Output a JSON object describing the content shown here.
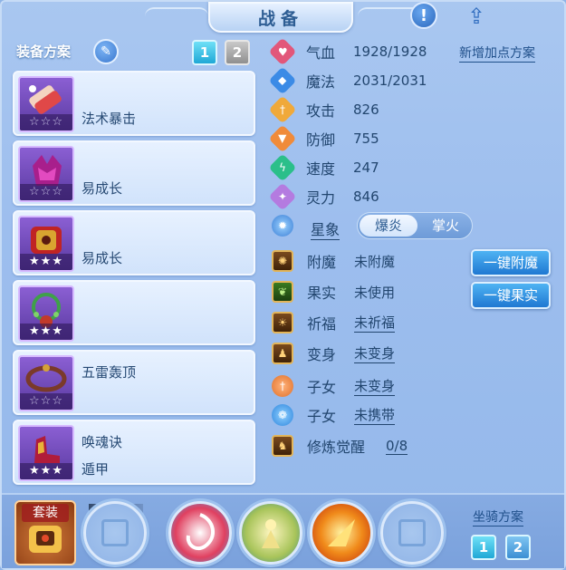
{
  "title": "战备",
  "equip_scheme": {
    "label": "装备方案",
    "tabs": [
      "1",
      "2"
    ],
    "active_tab": "1"
  },
  "equipment": [
    {
      "name": "法术暴击",
      "name2": "",
      "stars": 3,
      "filled": false,
      "color": "#d24a4a"
    },
    {
      "name": "易成长",
      "name2": "",
      "stars": 3,
      "filled": false,
      "color": "#b0209c"
    },
    {
      "name": "易成长",
      "name2": "",
      "stars": 3,
      "filled": true,
      "color": "#c2661c"
    },
    {
      "name": "",
      "name2": "",
      "stars": 3,
      "filled": true,
      "color": "#2f8a3a"
    },
    {
      "name": "五雷轰顶",
      "name2": "",
      "stars": 3,
      "filled": false,
      "color": "#8a3a2a"
    },
    {
      "name": "唤魂诀",
      "name2": "遁甲",
      "stars": 3,
      "filled": true,
      "color": "#b21c3a"
    }
  ],
  "attributes": [
    {
      "label": "气血",
      "value": "1928/1928",
      "icon": "heart-icon",
      "color": "#e2577a"
    },
    {
      "label": "魔法",
      "value": "2031/2031",
      "icon": "mana-icon",
      "color": "#3b8be6"
    },
    {
      "label": "攻击",
      "value": "826",
      "icon": "attack-icon",
      "color": "#f0a93a"
    },
    {
      "label": "防御",
      "value": "755",
      "icon": "defense-icon",
      "color": "#f08b3a"
    },
    {
      "label": "速度",
      "value": "247",
      "icon": "speed-icon",
      "color": "#2bbf8a"
    },
    {
      "label": "灵力",
      "value": "846",
      "icon": "spirit-icon",
      "color": "#b47be0"
    }
  ],
  "new_scheme_link": "新增加点方案",
  "constellation": {
    "label": "星象",
    "options": [
      "爆炎",
      "掌火"
    ],
    "selected": "爆炎"
  },
  "extras": [
    {
      "label": "附魔",
      "value": "未附魔",
      "underline": false,
      "icon": "enchant-icon"
    },
    {
      "label": "果实",
      "value": "未使用",
      "underline": false,
      "icon": "fruit-icon"
    },
    {
      "label": "祈福",
      "value": "未祈福",
      "underline": true,
      "icon": "blessing-icon"
    },
    {
      "label": "变身",
      "value": "未变身",
      "underline": true,
      "icon": "transform-icon"
    },
    {
      "label": "子女",
      "value": "未变身",
      "underline": true,
      "icon": "child-transform-icon"
    },
    {
      "label": "子女",
      "value": "未携带",
      "underline": true,
      "icon": "pet-paw-icon"
    },
    {
      "label": "修炼觉醒",
      "value": "0/8",
      "underline": true,
      "icon": "cultivation-icon"
    }
  ],
  "buttons": {
    "one_click_enchant": "一键附魔",
    "one_click_fruit": "一键果实"
  },
  "bottom": {
    "suit_label": "套装",
    "soul_skill_label": "魂技",
    "mount_scheme_label": "坐骑方案",
    "mount_tabs": [
      "1",
      "2"
    ]
  }
}
